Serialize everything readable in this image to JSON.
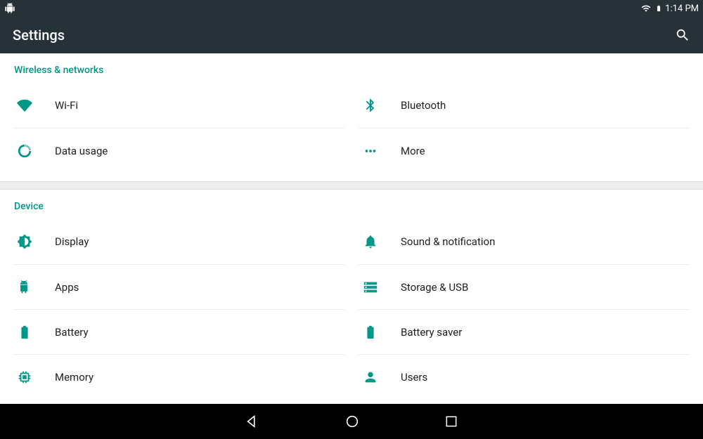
{
  "status": {
    "time": "1:14 PM"
  },
  "app": {
    "title": "Settings"
  },
  "sections": {
    "wireless": {
      "header": "Wireless & networks",
      "items": [
        {
          "label": "Wi-Fi"
        },
        {
          "label": "Bluetooth"
        },
        {
          "label": "Data usage"
        },
        {
          "label": "More"
        }
      ]
    },
    "device": {
      "header": "Device",
      "items": [
        {
          "label": "Display"
        },
        {
          "label": "Sound & notification"
        },
        {
          "label": "Apps"
        },
        {
          "label": "Storage & USB"
        },
        {
          "label": "Battery"
        },
        {
          "label": "Battery saver"
        },
        {
          "label": "Memory"
        },
        {
          "label": "Users"
        }
      ]
    }
  },
  "colors": {
    "accent": "#009688",
    "appbar": "#263238"
  }
}
